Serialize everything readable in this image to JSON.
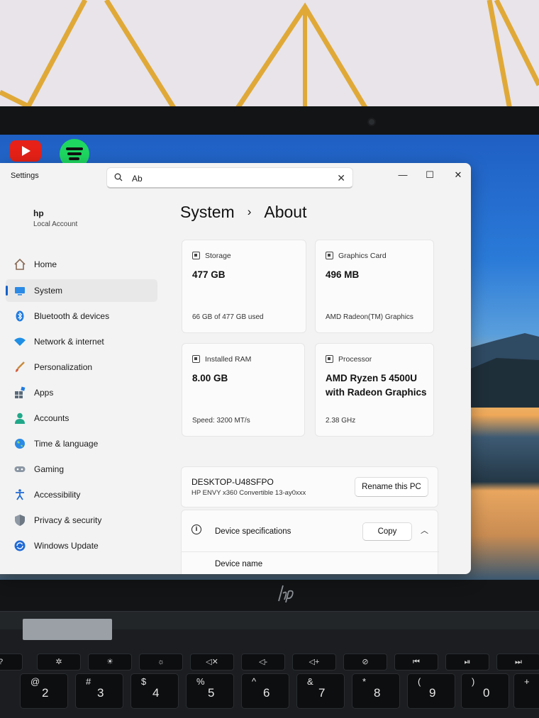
{
  "window": {
    "app_title": "Settings",
    "search_value": "Ab",
    "controls": {
      "minimize": "—",
      "maximize": "☐",
      "close": "✕"
    }
  },
  "user": {
    "name": "hp",
    "account_type": "Local Account"
  },
  "nav": [
    {
      "label": "Home",
      "icon": "home-icon",
      "active": false
    },
    {
      "label": "System",
      "icon": "system-icon",
      "active": true
    },
    {
      "label": "Bluetooth & devices",
      "icon": "bluetooth-icon",
      "active": false
    },
    {
      "label": "Network & internet",
      "icon": "wifi-icon",
      "active": false
    },
    {
      "label": "Personalization",
      "icon": "brush-icon",
      "active": false
    },
    {
      "label": "Apps",
      "icon": "apps-icon",
      "active": false
    },
    {
      "label": "Accounts",
      "icon": "person-icon",
      "active": false
    },
    {
      "label": "Time & language",
      "icon": "globe-icon",
      "active": false
    },
    {
      "label": "Gaming",
      "icon": "gamepad-icon",
      "active": false
    },
    {
      "label": "Accessibility",
      "icon": "accessibility-icon",
      "active": false
    },
    {
      "label": "Privacy & security",
      "icon": "shield-icon",
      "active": false
    },
    {
      "label": "Windows Update",
      "icon": "update-icon",
      "active": false
    }
  ],
  "breadcrumb": {
    "parent": "System",
    "separator": "›",
    "current": "About"
  },
  "cards": {
    "storage": {
      "header": "Storage",
      "value": "477 GB",
      "footer": "66 GB of 477 GB used"
    },
    "graphics": {
      "header": "Graphics Card",
      "value": "496 MB",
      "footer": "AMD Radeon(TM) Graphics"
    },
    "ram": {
      "header": "Installed RAM",
      "value": "8.00 GB",
      "footer": "Speed: 3200 MT/s"
    },
    "processor": {
      "header": "Processor",
      "value_line1": "AMD Ryzen 5 4500U",
      "value_line2": "with Radeon Graphics",
      "footer": "2.38 GHz"
    }
  },
  "pc": {
    "name": "DESKTOP-U48SFPO",
    "model": "HP ENVY x360 Convertible 13-ay0xxx",
    "rename_label": "Rename this PC"
  },
  "specs": {
    "title": "Device specifications",
    "copy_label": "Copy",
    "first_row": "Device name"
  },
  "keyboard": {
    "number_keys": [
      {
        "shift": "@",
        "main": "2"
      },
      {
        "shift": "#",
        "main": "3"
      },
      {
        "shift": "$",
        "main": "4"
      },
      {
        "shift": "%",
        "main": "5"
      },
      {
        "shift": "^",
        "main": "6"
      },
      {
        "shift": "&",
        "main": "7"
      },
      {
        "shift": "*",
        "main": "8"
      },
      {
        "shift": "(",
        "main": "9"
      },
      {
        "shift": ")",
        "main": "0"
      }
    ]
  },
  "colors": {
    "accent": "#1460c8",
    "window_bg": "#f3f3f3",
    "card_bg": "#fbfbfb"
  }
}
